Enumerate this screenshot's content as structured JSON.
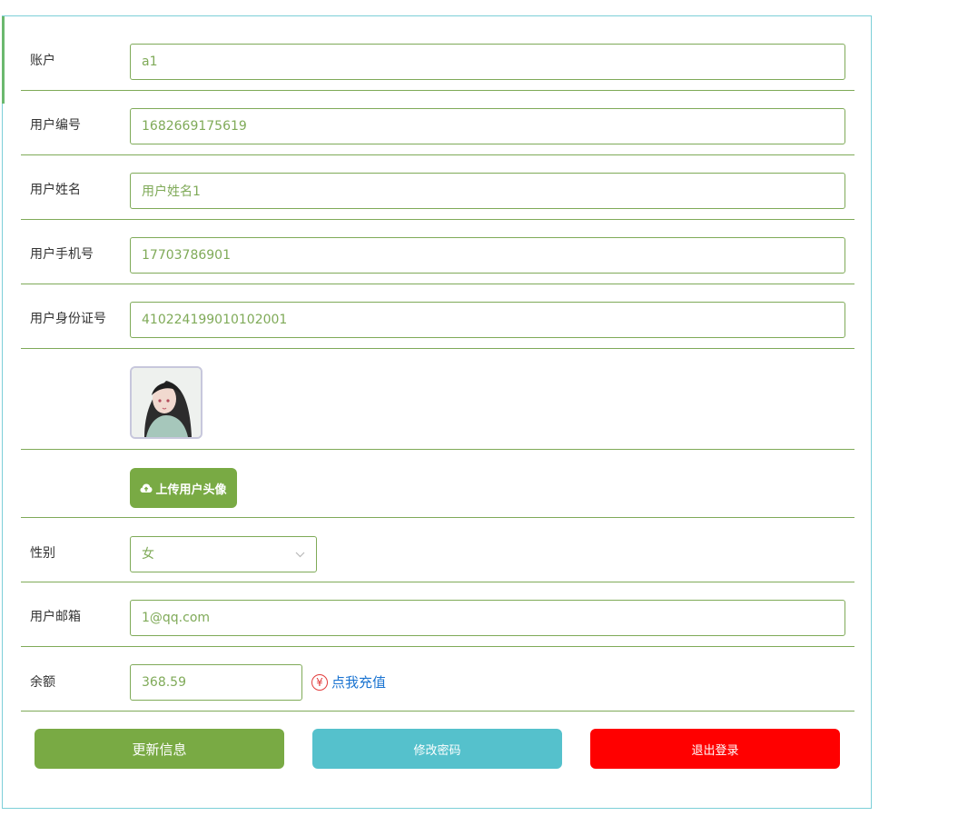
{
  "form": {
    "account": {
      "label": "账户",
      "value": "a1"
    },
    "user_id": {
      "label": "用户编号",
      "value": "1682669175619"
    },
    "user_name": {
      "label": "用户姓名",
      "value": "用户姓名1"
    },
    "phone": {
      "label": "用户手机号",
      "value": "17703786901"
    },
    "id_card": {
      "label": "用户身份证号",
      "value": "410224199010102001"
    },
    "upload_avatar_label": "上传用户头像",
    "gender": {
      "label": "性别",
      "value": "女"
    },
    "email": {
      "label": "用户邮箱",
      "value": "1@qq.com"
    },
    "balance": {
      "label": "余额",
      "value": "368.59",
      "recharge_label": "点我充值"
    }
  },
  "actions": {
    "update_label": "更新信息",
    "change_password_label": "修改密码",
    "logout_label": "退出登录"
  },
  "colors": {
    "update": "#79aa44",
    "change_password": "#55c1cc",
    "logout": "#ff0000"
  }
}
